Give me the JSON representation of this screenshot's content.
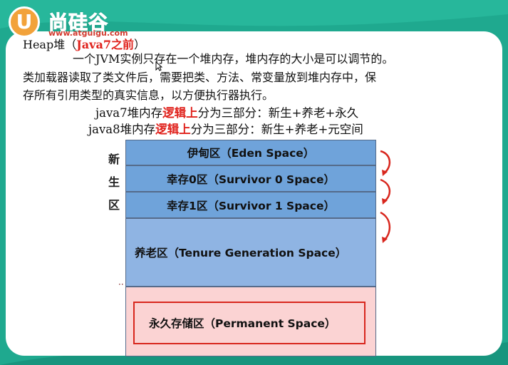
{
  "logo": {
    "badge": "U",
    "name": "尚硅谷",
    "url": "www.atguigu.com"
  },
  "text": {
    "heap_title_prefix": "Heap堆（",
    "heap_title_red": "Java7之前",
    "heap_title_suffix": "）",
    "para1": "一个JVM实例只存在一个堆内存，堆内存的大小是可以调节的。",
    "para2": "类加载器读取了类文件后，需要把类、方法、常变量放到堆内存中，保",
    "para3": "存所有引用类型的真实信息，以方便执行器执行。",
    "java7_a": "java7堆内存",
    "java7_red": "逻辑上",
    "java7_b": "分为三部分：新生+养老+永久",
    "java8_a": "java8堆内存",
    "java8_red": "逻辑上",
    "java8_b": "分为三部分：新生+养老+元空间"
  },
  "diagram": {
    "side_label": [
      "新",
      "生",
      "区"
    ],
    "eden": "伊甸区（Eden Space）",
    "survivor0": "幸存0区（Survivor 0 Space）",
    "survivor1": "幸存1区（Survivor 1 Space）",
    "tenure": "养老区（Tenure Generation Space）",
    "permanent": "永久存储区（Permanent Space）",
    "colors": {
      "young": "#6fa3da",
      "tenure": "#8fb4e3",
      "permanent": "#fbd3d3",
      "highlight": "#e0221c"
    }
  }
}
